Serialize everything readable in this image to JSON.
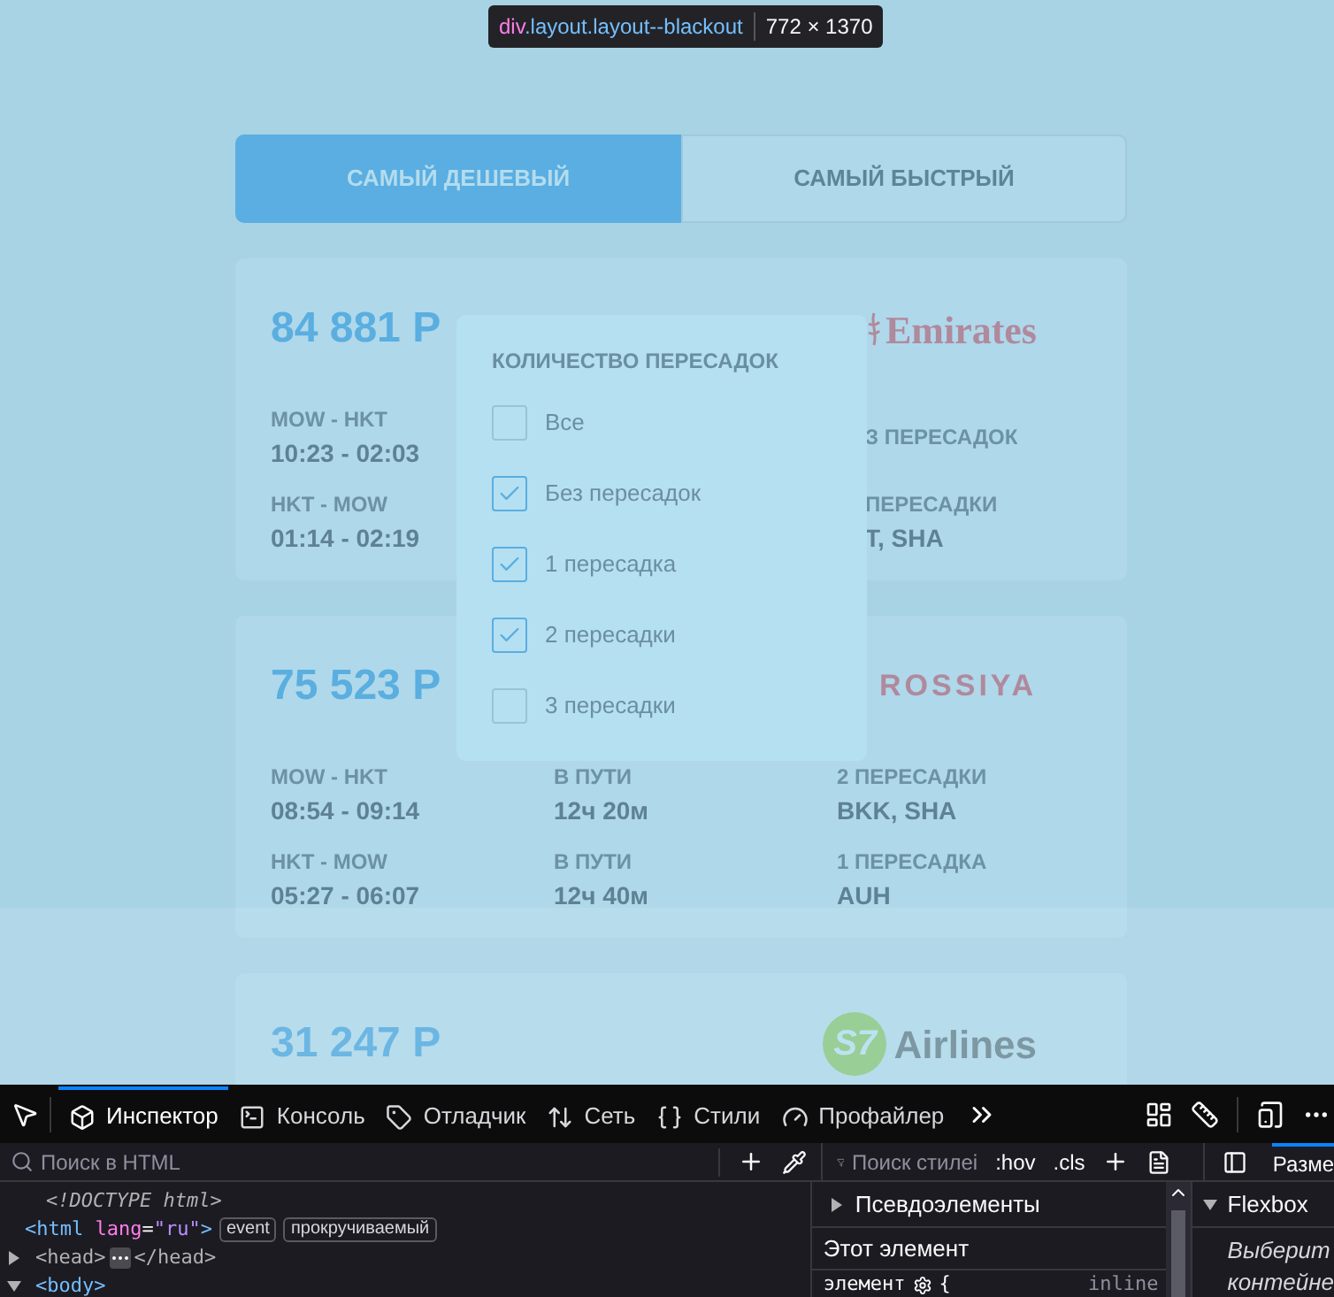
{
  "inspector_tooltip": {
    "tag": "div",
    "classes": ".layout.layout--blackout",
    "size": "772 × 1370"
  },
  "tabs": [
    {
      "label": "САМЫЙ ДЕШЕВЫЙ",
      "selected": true
    },
    {
      "label": "САМЫЙ БЫСТРЫЙ",
      "selected": false
    }
  ],
  "tickets": [
    {
      "kind": "covered",
      "price": "84 881 Р",
      "logo": {
        "kind": "emirates",
        "text": "Emirates"
      },
      "rows": [
        {
          "columns": [
            {
              "label": "MOW - HKT",
              "value": "10:23 - 02:03"
            },
            {
              "label": "З ПЕРЕСАДОК"
            }
          ]
        },
        {
          "columns": [
            {
              "label": "HKT - MOW",
              "value": "01:14 - 02:19"
            },
            {
              "label": "ПЕРЕСАДКИ",
              "value": "T, SHA"
            }
          ]
        }
      ]
    },
    {
      "kind": "full",
      "price": "75 523 Р",
      "logo": {
        "kind": "rossiya",
        "text": "ROSSIYA"
      },
      "rows": [
        {
          "columns": [
            {
              "label": "MOW - HKT",
              "value": "08:54 - 09:14"
            },
            {
              "label": "В ПУТИ",
              "value": "12ч 20м"
            },
            {
              "label": "2 ПЕРЕСАДКИ",
              "value": "BKK, SHA"
            }
          ]
        },
        {
          "columns": [
            {
              "label": "HKT - MOW",
              "value": "05:27 - 06:07"
            },
            {
              "label": "В ПУТИ",
              "value": "12ч 40м"
            },
            {
              "label": "1 ПЕРЕСАДКА",
              "value": "AUH"
            }
          ]
        }
      ]
    },
    {
      "kind": "cut",
      "price": "31 247 Р",
      "logo": {
        "kind": "s7",
        "badge": "S7",
        "text": "Airlines"
      }
    }
  ],
  "filter_popup": {
    "title": "КОЛИЧЕСТВО ПЕРЕСАДОК",
    "options": [
      {
        "label": "Все",
        "checked": false
      },
      {
        "label": "Без пересадок",
        "checked": true
      },
      {
        "label": "1 пересадка",
        "checked": true
      },
      {
        "label": "2 пересадки",
        "checked": true
      },
      {
        "label": "3 пересадки",
        "checked": false
      }
    ]
  },
  "devtools": {
    "tools": [
      {
        "kind": "inspector",
        "label": "Инспектор",
        "selected": true
      },
      {
        "kind": "console",
        "label": "Консоль",
        "selected": false
      },
      {
        "kind": "debugger",
        "label": "Отладчик",
        "selected": false
      },
      {
        "kind": "network",
        "label": "Сеть",
        "selected": false
      },
      {
        "kind": "styles",
        "label": "Стили",
        "selected": false
      },
      {
        "kind": "profiler",
        "label": "Профайлер",
        "selected": false
      }
    ],
    "html_search_placeholder": "Поиск в HTML",
    "html_lines": [
      {
        "kind": "doctype",
        "text": "<!DOCTYPE html>"
      },
      {
        "kind": "element",
        "tag": "<html",
        "attr": "lang",
        "eq": "=",
        "value": "\"ru\"",
        "close": ">",
        "badges": [
          "event",
          "прокручиваемый"
        ]
      },
      {
        "kind": "collapsed",
        "open": "<head>",
        "close": "</head>",
        "expanded": false
      },
      {
        "kind": "open",
        "open": "<body>",
        "expanded": true
      }
    ],
    "styles_search_placeholder": "Поиск стилеі",
    "hov": ":hov",
    "cls": ".cls",
    "pseudo_elements": {
      "label": "Псевдоэлементы",
      "expanded": false
    },
    "this_element": "Этот элемент",
    "rule": {
      "selector": "элемент",
      "brace": "{",
      "source": "inline"
    },
    "layout_tab": "Разме",
    "flexbox": {
      "label": "Flexbox",
      "expanded": true
    },
    "flexbox_hint": [
      "Выберит",
      "контейне"
    ]
  }
}
